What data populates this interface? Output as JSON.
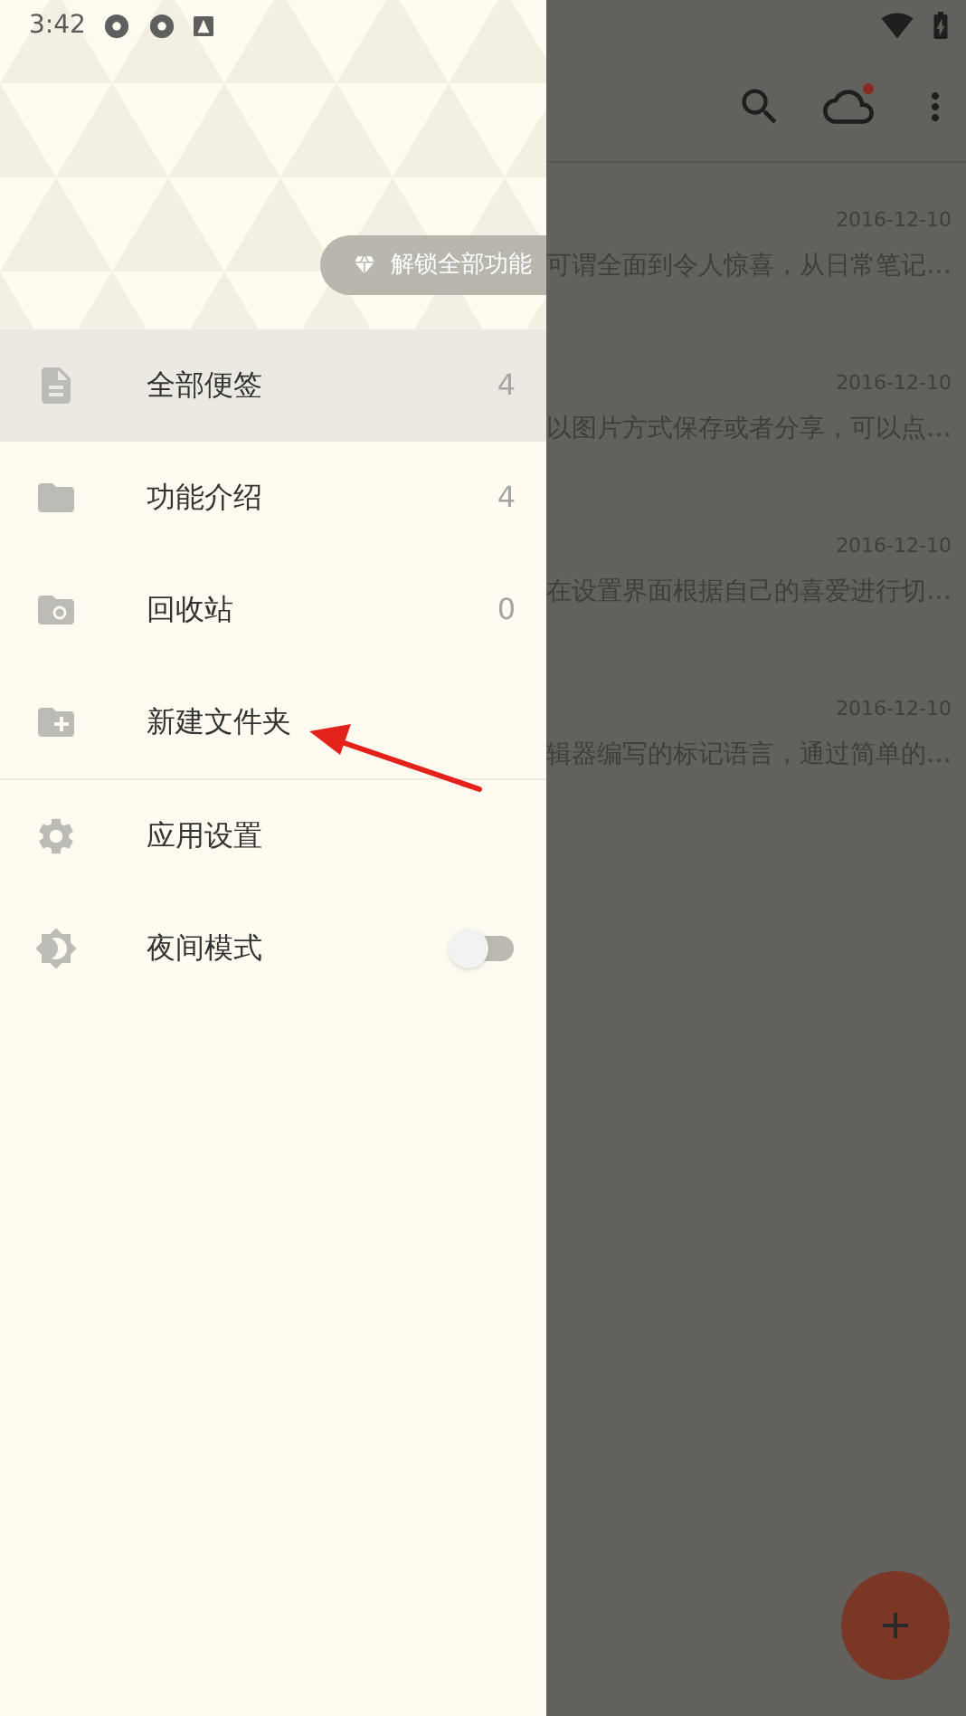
{
  "status_bar": {
    "time": "3:42"
  },
  "drawer": {
    "unlock_button": "解锁全部功能",
    "items": [
      {
        "kind": "notes",
        "label": "全部便签",
        "count": "4",
        "selected": true
      },
      {
        "kind": "folder",
        "label": "功能介绍",
        "count": "4",
        "selected": false
      },
      {
        "kind": "trash",
        "label": "回收站",
        "count": "0",
        "selected": false
      },
      {
        "kind": "new-folder",
        "label": "新建文件夹",
        "selected": false
      }
    ],
    "settings": [
      {
        "kind": "settings",
        "label": "应用设置"
      },
      {
        "kind": "night",
        "label": "夜间模式",
        "on": false
      }
    ]
  },
  "notes": [
    {
      "date": "2016-12-10",
      "snippet": "可谓全面到令人惊喜，从日常笔记…"
    },
    {
      "date": "2016-12-10",
      "snippet": "以图片方式保存或者分享，可以点…"
    },
    {
      "date": "2016-12-10",
      "snippet": "在设置界面根据自己的喜爱进行切…"
    },
    {
      "date": "2016-12-10",
      "snippet": "辑器编写的标记语言，通过简单的…"
    }
  ],
  "annotation": {
    "kind": "arrow"
  }
}
